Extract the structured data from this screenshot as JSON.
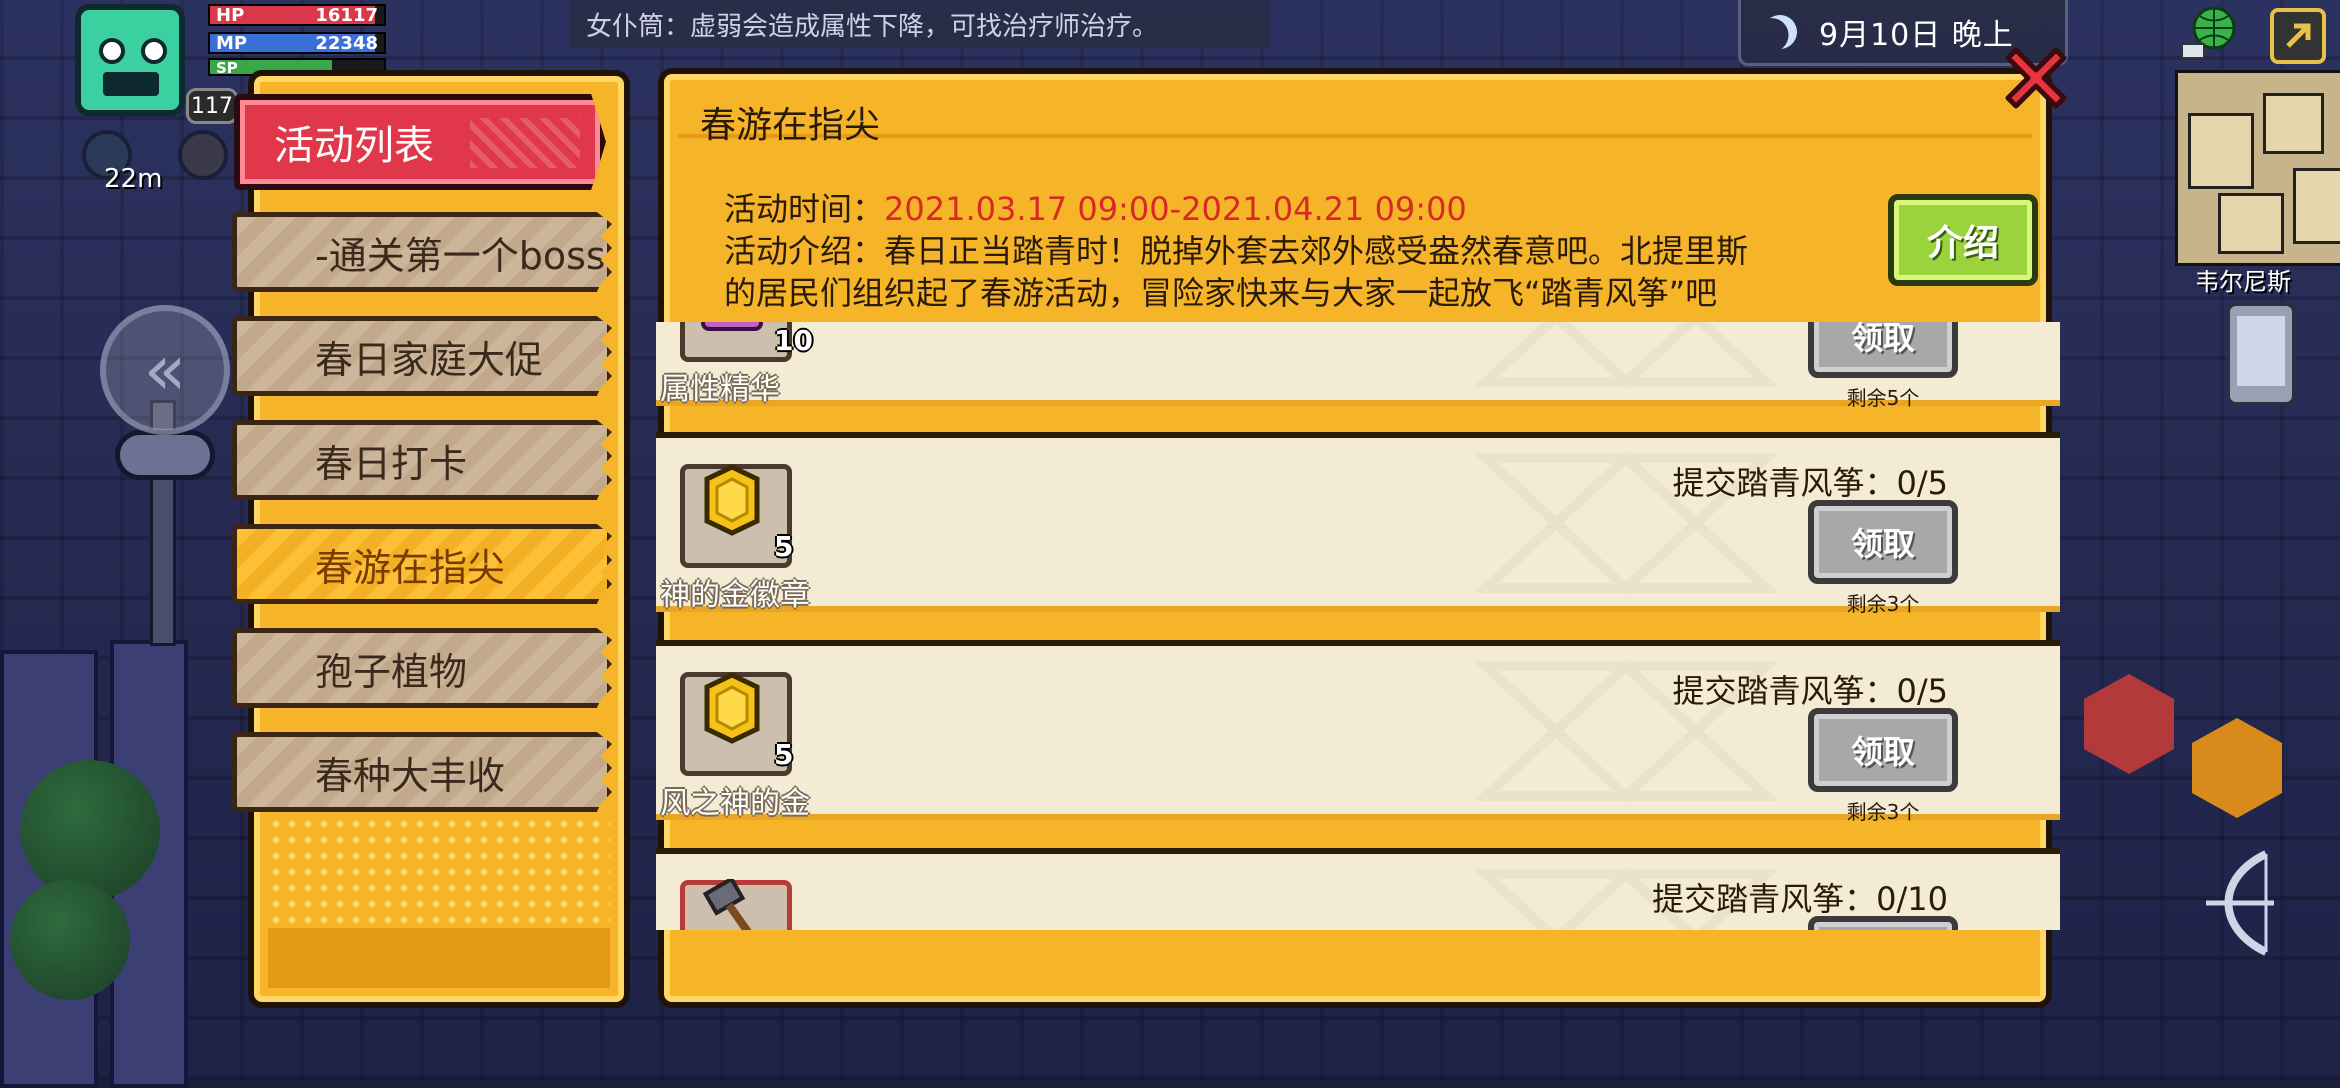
{
  "hud": {
    "level": "117",
    "hp_label": "HP",
    "hp_value": "16117",
    "hp_fill": 0.95,
    "mp_label": "MP",
    "mp_value": "22348",
    "mp_fill": 0.95,
    "sp_label": "SP",
    "sp_fill": 0.7,
    "distance": "22m",
    "notice": "女仆筒：虚弱会造成属性下降，可找治疗师治疗。",
    "date": "9月10日 晚上",
    "npc_name": "韦尔尼斯"
  },
  "sidebar": {
    "header": "活动列表",
    "items": [
      {
        "label": "-通关第一个boss"
      },
      {
        "label": "春日家庭大促"
      },
      {
        "label": "春日打卡"
      },
      {
        "label": "春游在指尖"
      },
      {
        "label": "孢子植物"
      },
      {
        "label": "春种大丰收"
      }
    ],
    "selected_index": 3
  },
  "event": {
    "title": "春游在指尖",
    "time_label": "活动时间：",
    "time_value": "2021.03.17 09:00-2021.04.21 09:00",
    "intro_line1": "活动介绍：春日正当踏青时！脱掉外套去郊外感受盎然春意吧。北提里斯",
    "intro_line2": "的居民们组织起了春游活动，冒险家快来与大家一起放飞“踏青风筝”吧",
    "intro_button": "介绍"
  },
  "rewards": [
    {
      "name": "属性精华",
      "count": "10",
      "requirement": "",
      "button": "领取",
      "remaining": "剩余5个"
    },
    {
      "name": "神的金徽章",
      "count": "5",
      "requirement": "提交踏青风筝：0/5",
      "button": "领取",
      "remaining": "剩余3个"
    },
    {
      "name": "风之神的金",
      "count": "5",
      "requirement": "提交踏青风筝：0/5",
      "button": "领取",
      "remaining": "剩余3个"
    },
    {
      "name": "",
      "count": "",
      "requirement": "提交踏青风筝：0/10",
      "button": "",
      "remaining": ""
    }
  ],
  "colors": {
    "panel": "#f6b529",
    "header_tab": "#e0384a",
    "intro_button": "#9bd33c",
    "claim_button": "#a8a8a8",
    "time_text": "#d72a24"
  }
}
